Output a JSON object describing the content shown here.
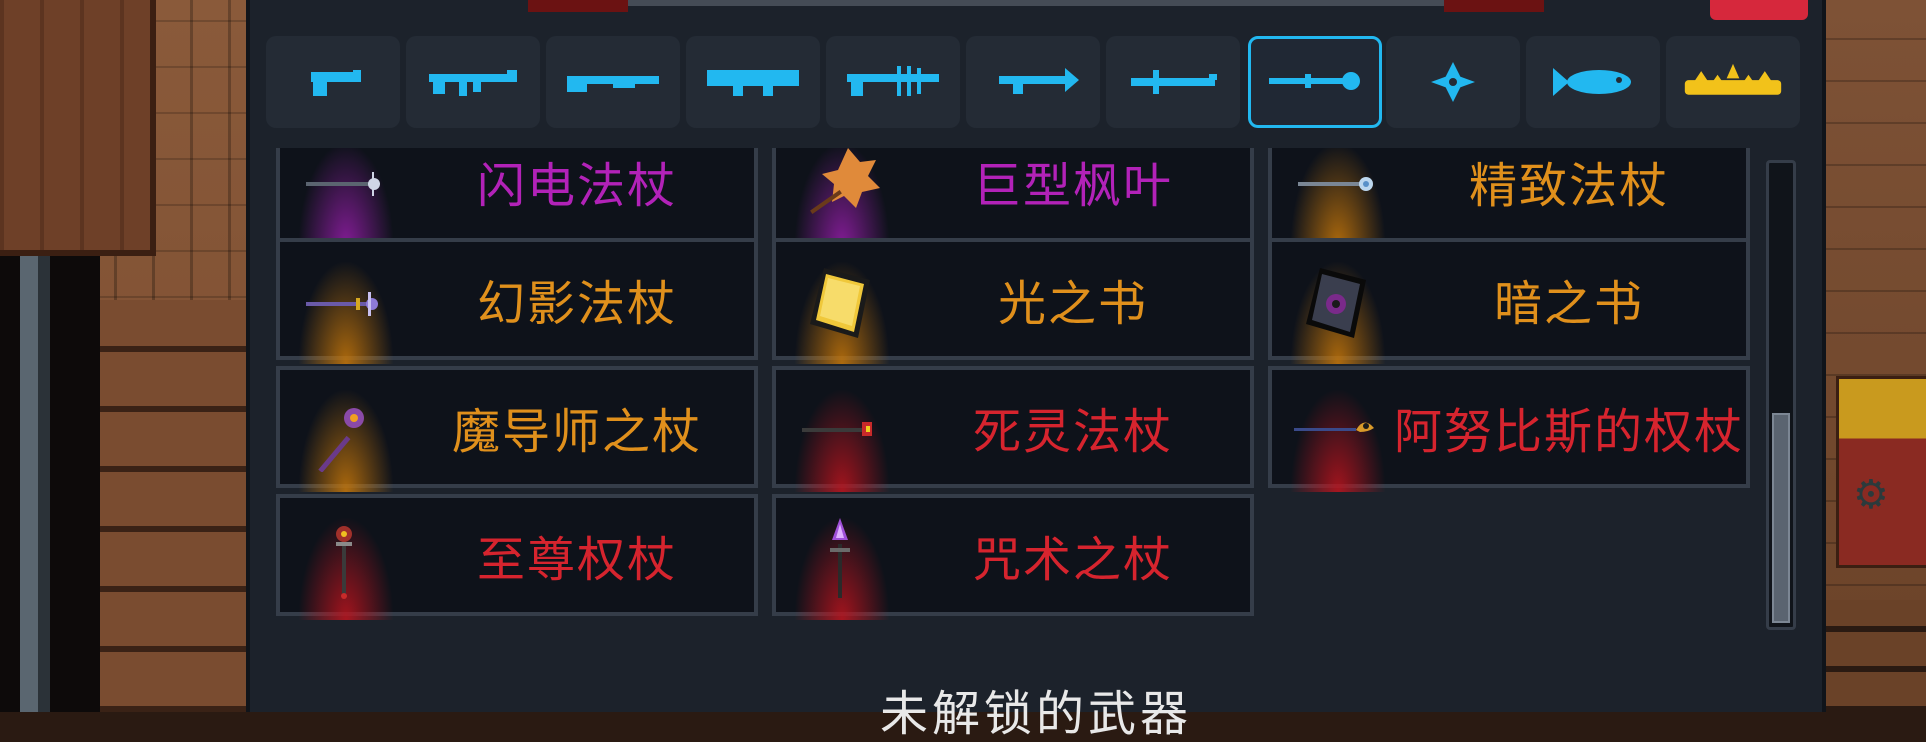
{
  "colors": {
    "tab_icon": "#22b8f0",
    "tab_active_border": "#22b8f0",
    "gold_icon": "#f2c21a",
    "rarity_purple": "#b222b8",
    "rarity_orange": "#e0901c",
    "rarity_red": "#d6242e"
  },
  "tabs": [
    {
      "icon": "pistol-icon"
    },
    {
      "icon": "assault-rifle-icon"
    },
    {
      "icon": "shotgun-icon"
    },
    {
      "icon": "launcher-icon"
    },
    {
      "icon": "special-gun-icon"
    },
    {
      "icon": "bow-icon"
    },
    {
      "icon": "sword-icon"
    },
    {
      "icon": "staff-icon",
      "active": true
    },
    {
      "icon": "shuriken-icon"
    },
    {
      "icon": "fish-icon"
    },
    {
      "icon": "crown-icon"
    }
  ],
  "weapons": [
    {
      "name": "闪电法杖",
      "rarity": "purple",
      "icon": "lightning-staff-icon"
    },
    {
      "name": "巨型枫叶",
      "rarity": "purple",
      "icon": "maple-leaf-icon"
    },
    {
      "name": "精致法杖",
      "rarity": "orange",
      "icon": "exquisite-staff-icon"
    },
    {
      "name": "幻影法杖",
      "rarity": "orange",
      "icon": "phantom-staff-icon"
    },
    {
      "name": "光之书",
      "rarity": "orange",
      "icon": "book-of-light-icon"
    },
    {
      "name": "暗之书",
      "rarity": "orange",
      "icon": "book-of-dark-icon"
    },
    {
      "name": "魔导师之杖",
      "rarity": "orange",
      "icon": "mage-staff-icon"
    },
    {
      "name": "死灵法杖",
      "rarity": "red",
      "icon": "necro-staff-icon"
    },
    {
      "name": "阿努比斯的权杖",
      "rarity": "red",
      "icon": "anubis-scepter-icon"
    },
    {
      "name": "至尊权杖",
      "rarity": "red",
      "icon": "supreme-scepter-icon"
    },
    {
      "name": "咒术之杖",
      "rarity": "red",
      "icon": "curse-staff-icon"
    }
  ],
  "footer": {
    "text": "未解锁的武器"
  }
}
